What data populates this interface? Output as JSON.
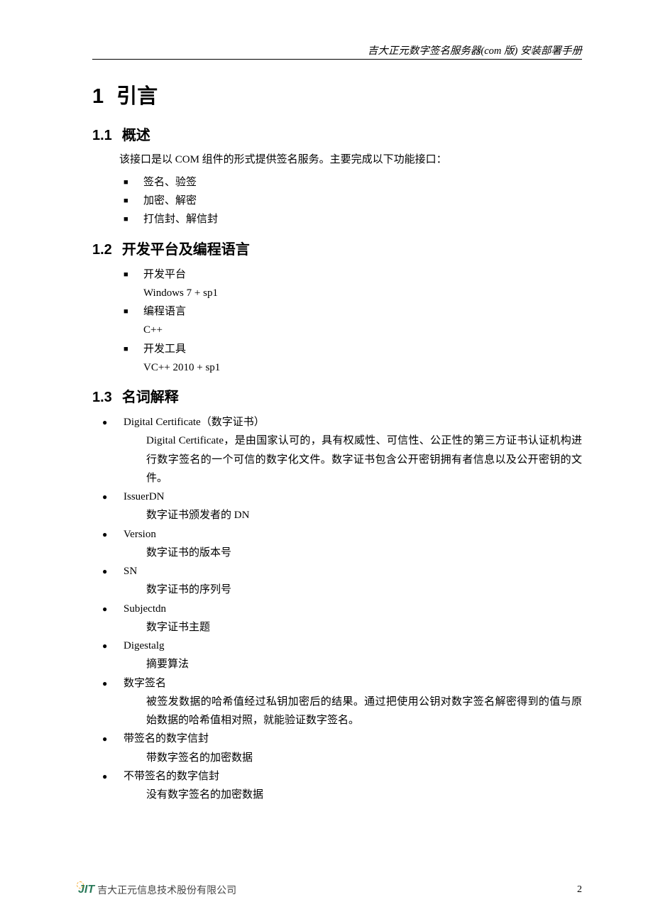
{
  "header": {
    "title": "吉大正元数字签名服务器(com 版)  安装部署手册"
  },
  "section1": {
    "number": "1",
    "title": "引言"
  },
  "section1_1": {
    "number": "1.1",
    "title": "概述",
    "intro": "该接口是以 COM 组件的形式提供签名服务。主要完成以下功能接口：",
    "items": [
      "签名、验签",
      "加密、解密",
      "打信封、解信封"
    ]
  },
  "section1_2": {
    "number": "1.2",
    "title": "开发平台及编程语言",
    "items": [
      {
        "label": "开发平台",
        "value": "Windows 7 + sp1"
      },
      {
        "label": "编程语言",
        "value": "C++"
      },
      {
        "label": "开发工具",
        "value": "VC++ 2010 + sp1"
      }
    ]
  },
  "section1_3": {
    "number": "1.3",
    "title": "名词解释",
    "terms": [
      {
        "name": "Digital Certificate（数字证书）",
        "desc": "Digital Certificate，是由国家认可的，具有权威性、可信性、公正性的第三方证书认证机构进行数字签名的一个可信的数字化文件。数字证书包含公开密钥拥有者信息以及公开密钥的文件。"
      },
      {
        "name": "IssuerDN",
        "desc": "数字证书颁发者的 DN"
      },
      {
        "name": "Version",
        "desc": "数字证书的版本号"
      },
      {
        "name": "SN",
        "desc": "数字证书的序列号"
      },
      {
        "name": "Subjectdn",
        "desc": "数字证书主题"
      },
      {
        "name": "Digestalg",
        "desc": "摘要算法"
      },
      {
        "name": "数字签名",
        "desc": "被签发数据的哈希值经过私钥加密后的结果。通过把使用公钥对数字签名解密得到的值与原始数据的哈希值相对照，就能验证数字签名。"
      },
      {
        "name": "带签名的数字信封",
        "desc": "带数字签名的加密数据"
      },
      {
        "name": "不带签名的数字信封",
        "desc": "没有数字签名的加密数据"
      }
    ]
  },
  "footer": {
    "logo": "JIT",
    "company": "吉大正元信息技术股份有限公司",
    "page": "2"
  }
}
